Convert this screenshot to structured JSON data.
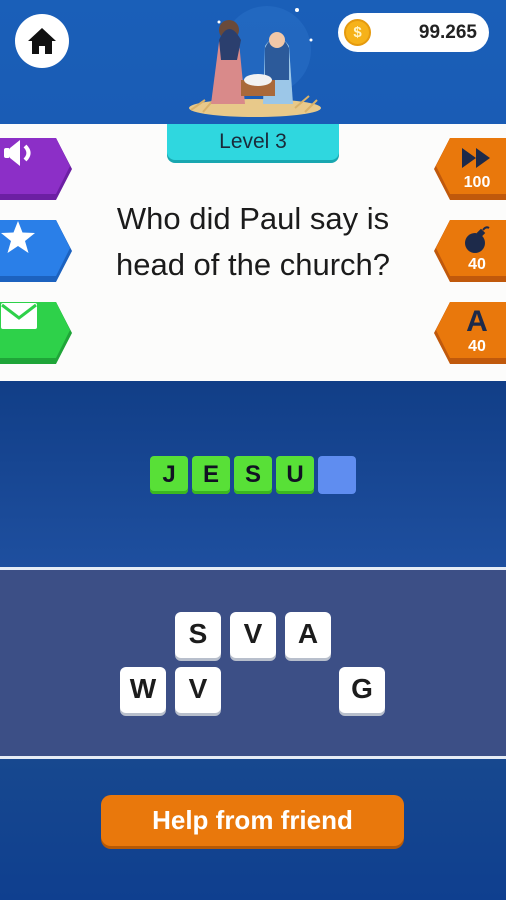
{
  "header": {
    "coins": "99.265",
    "coin_symbol": "$"
  },
  "level": {
    "label": "Level 3"
  },
  "question": {
    "text": "Who did Paul say is head of the church?"
  },
  "left_buttons": [
    {
      "name": "sound",
      "icon": "speaker-icon",
      "color": "#8c2fc7"
    },
    {
      "name": "rate",
      "icon": "star-icon",
      "color": "#2a7fe8"
    },
    {
      "name": "share",
      "icon": "mail-icon",
      "color": "#2ed14a"
    }
  ],
  "hints": [
    {
      "icon": "fast-forward-icon",
      "cost": "100"
    },
    {
      "icon": "bomb-icon",
      "cost": "40"
    },
    {
      "icon": "reveal-letter-icon",
      "glyph": "A",
      "cost": "40"
    }
  ],
  "answer": {
    "letters": [
      "J",
      "E",
      "S",
      "U",
      ""
    ]
  },
  "tiles": {
    "row1": [
      "S",
      "V",
      "A"
    ],
    "row2": [
      "W",
      "V",
      "G"
    ]
  },
  "help_button": {
    "label": "Help from friend"
  },
  "colors": {
    "accent_orange": "#e9780c",
    "answer_green": "#58e037",
    "level_cyan": "#2fd7df"
  }
}
